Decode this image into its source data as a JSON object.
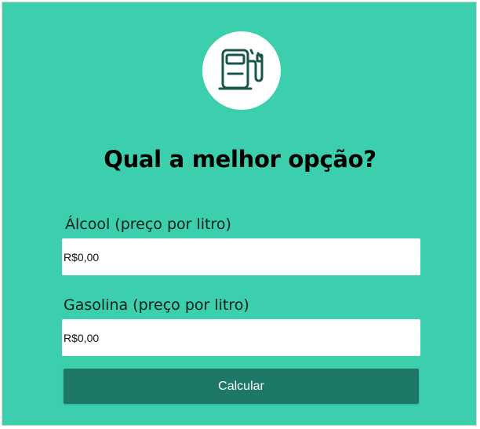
{
  "app": {
    "icon": "fuel-pump-icon",
    "title": "Qual a melhor opção?"
  },
  "form": {
    "alcool": {
      "label": "Álcool (preço por litro)",
      "placeholder": "R$0,00",
      "value": ""
    },
    "gasolina": {
      "label": "Gasolina (preço por litro)",
      "placeholder": "R$0,00",
      "value": ""
    },
    "submit_label": "Calcular"
  },
  "colors": {
    "background": "#3bcfad",
    "button": "#1e7868",
    "icon_stroke": "#17574b",
    "text": "#000000"
  }
}
